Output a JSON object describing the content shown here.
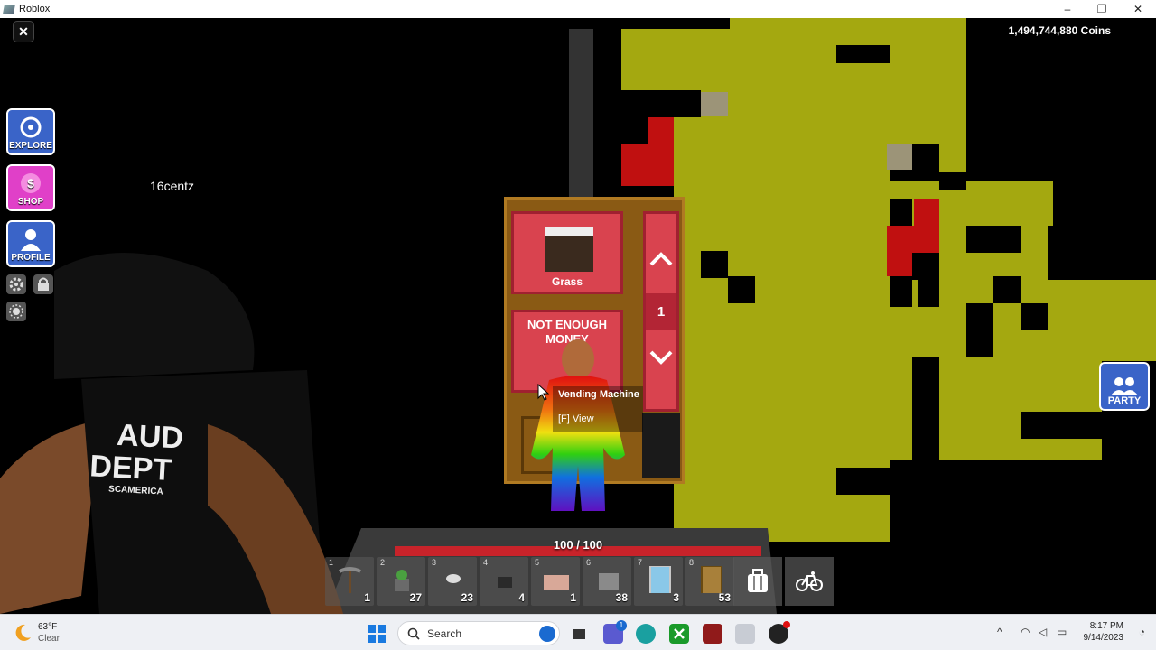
{
  "window": {
    "title": "Roblox",
    "minimize": "–",
    "restore": "❐",
    "close": "✕"
  },
  "hud": {
    "close_label": "✕",
    "coins": "1,494,744,880 Coins",
    "player_name": "16centz",
    "menu": [
      {
        "label": "EXPLORE",
        "icon": "compass-icon",
        "color": "#3a64c8"
      },
      {
        "label": "SHOP",
        "icon": "dollar-icon",
        "color": "#e040c8"
      },
      {
        "label": "PROFILE",
        "icon": "person-icon",
        "color": "#3a64c8"
      }
    ],
    "party_label": "PARTY",
    "health": {
      "text": "100 / 100",
      "value": 100,
      "max": 100
    }
  },
  "vending_machine": {
    "item_name": "Grass",
    "status": "NOT ENOUGH MONEY",
    "quantity": "1",
    "prompt_title": "Vending Machine",
    "prompt_action": "[F] View"
  },
  "shirt": {
    "line1": "AUD",
    "line2": "DEPT",
    "line3": "SCAMERICA"
  },
  "hotbar": [
    {
      "slot": "1",
      "count": "1",
      "icon": "pickaxe-icon"
    },
    {
      "slot": "2",
      "count": "27",
      "icon": "plant-block-icon"
    },
    {
      "slot": "3",
      "count": "23",
      "icon": "cloud-block-icon"
    },
    {
      "slot": "4",
      "count": "4",
      "icon": "dark-block-icon"
    },
    {
      "slot": "5",
      "count": "1",
      "icon": "pink-block-icon"
    },
    {
      "slot": "6",
      "count": "38",
      "icon": "stone-block-icon"
    },
    {
      "slot": "7",
      "count": "3",
      "icon": "ice-machine-icon"
    },
    {
      "slot": "8",
      "count": "53",
      "icon": "vending-machine-icon"
    }
  ],
  "hotbar_tools": [
    {
      "icon": "backpack-icon"
    },
    {
      "icon": "bicycle-icon"
    }
  ],
  "taskbar": {
    "weather_temp": "63°F",
    "weather_desc": "Clear",
    "search_placeholder": "Search",
    "time": "8:17 PM",
    "date": "9/14/2023",
    "notification_badge": "1"
  },
  "colors": {
    "pixel_yellow": "#a4a810",
    "pixel_red": "#c01010",
    "pixel_tan": "#9c9478",
    "vending_red": "#d9434f"
  }
}
